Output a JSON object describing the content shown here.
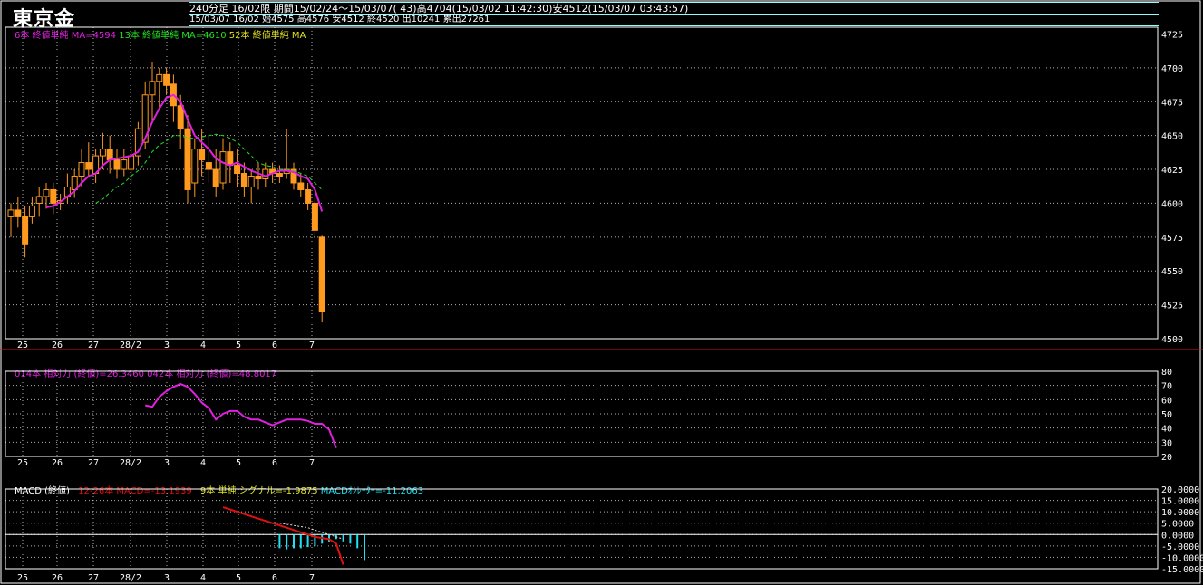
{
  "header": {
    "title": "東京金",
    "period_label": "240分足",
    "contract": "16/02限",
    "range_info": "期間15/02/24〜15/03/07( 43)高4704(15/03/02 11:42:30)安4512(15/03/07 03:43:57)",
    "last_bar_info": "15/03/07 16/02 始4575 高4576 安4512 終4520 出10241 累出27261"
  },
  "legend": {
    "ma1": "6本 終値単純 MA=4594",
    "ma2": "13本 終値単純 MA=4610",
    "ma3": "52本 終値単純 MA",
    "rsi1": "014本 相対力 (終値)=26.3460",
    "rsi2": "042本 相対力 (終値)=48.8017",
    "macd_title": "MACD (終値)",
    "macd_line": "12-26本 MACD=-13.1939",
    "macd_signal": "9本 単純 シグナル=-1.9875",
    "macd_osc": "MACDｵｼﾚｰﾀｰ=-11.2063"
  },
  "colors": {
    "candle": "#ff9a1f",
    "ma6": "#e020e0",
    "ma13": "#20e020",
    "rsi": "#e020e0",
    "macd": "#e01010",
    "signal": "#e0e0e0",
    "osc": "#20e0f0",
    "frame": "#ffffff",
    "divider": "#e01010",
    "grid": "#ffffff"
  },
  "xaxis": {
    "date_labels": [
      "25",
      "26",
      "27",
      "28/2",
      "3",
      "4",
      "5",
      "6",
      "7"
    ]
  },
  "chart_data": [
    {
      "type": "candlestick",
      "ylim": [
        4500,
        4730
      ],
      "yticks": [
        4500,
        4525,
        4550,
        4575,
        4600,
        4625,
        4650,
        4675,
        4700,
        4725
      ],
      "ohlc": [
        [
          4590,
          4600,
          4575,
          4595
        ],
        [
          4595,
          4605,
          4582,
          4590
        ],
        [
          4590,
          4598,
          4560,
          4570
        ],
        [
          4590,
          4605,
          4585,
          4598
        ],
        [
          4600,
          4612,
          4590,
          4605
        ],
        [
          4605,
          4615,
          4596,
          4610
        ],
        [
          4610,
          4615,
          4592,
          4600
        ],
        [
          4600,
          4607,
          4595,
          4602
        ],
        [
          4605,
          4622,
          4600,
          4612
        ],
        [
          4610,
          4625,
          4604,
          4620
        ],
        [
          4620,
          4640,
          4612,
          4630
        ],
        [
          4630,
          4645,
          4620,
          4625
        ],
        [
          4622,
          4640,
          4615,
          4635
        ],
        [
          4635,
          4652,
          4625,
          4640
        ],
        [
          4640,
          4650,
          4622,
          4632
        ],
        [
          4632,
          4640,
          4618,
          4625
        ],
        [
          4625,
          4640,
          4620,
          4632
        ],
        [
          4625,
          4642,
          4615,
          4635
        ],
        [
          4635,
          4660,
          4628,
          4655
        ],
        [
          4645,
          4690,
          4640,
          4680
        ],
        [
          4680,
          4704,
          4660,
          4690
        ],
        [
          4690,
          4700,
          4670,
          4695
        ],
        [
          4695,
          4700,
          4680,
          4687
        ],
        [
          4688,
          4695,
          4660,
          4672
        ],
        [
          4672,
          4680,
          4640,
          4655
        ],
        [
          4655,
          4665,
          4600,
          4610
        ],
        [
          4615,
          4648,
          4605,
          4640
        ],
        [
          4640,
          4655,
          4620,
          4632
        ],
        [
          4630,
          4650,
          4615,
          4625
        ],
        [
          4625,
          4640,
          4605,
          4612
        ],
        [
          4615,
          4648,
          4610,
          4638
        ],
        [
          4638,
          4645,
          4615,
          4628
        ],
        [
          4628,
          4640,
          4612,
          4622
        ],
        [
          4622,
          4630,
          4605,
          4612
        ],
        [
          4612,
          4625,
          4600,
          4620
        ],
        [
          4620,
          4630,
          4610,
          4618
        ],
        [
          4618,
          4630,
          4612,
          4625
        ],
        [
          4625,
          4630,
          4615,
          4622
        ],
        [
          4622,
          4628,
          4615,
          4620
        ],
        [
          4622,
          4655,
          4618,
          4625
        ],
        [
          4625,
          4630,
          4610,
          4615
        ],
        [
          4615,
          4622,
          4605,
          4610
        ],
        [
          4610,
          4615,
          4595,
          4600
        ],
        [
          4600,
          4605,
          4575,
          4580
        ],
        [
          4575,
          4576,
          4512,
          4520
        ]
      ],
      "ma6": [
        null,
        null,
        null,
        null,
        null,
        4597,
        4598,
        4601,
        4605,
        4609,
        4615,
        4620,
        4622,
        4628,
        4632,
        4633,
        4634,
        4635,
        4638,
        4648,
        4660,
        4670,
        4678,
        4680,
        4675,
        4662,
        4650,
        4645,
        4640,
        4633,
        4630,
        4628,
        4630,
        4627,
        4624,
        4622,
        4620,
        4622,
        4624,
        4624,
        4623,
        4620,
        4618,
        4610,
        4594
      ],
      "ma13": [
        null,
        null,
        null,
        null,
        null,
        null,
        null,
        null,
        null,
        null,
        null,
        null,
        4600,
        4603,
        4608,
        4612,
        4615,
        4620,
        4624,
        4630,
        4638,
        4643,
        4646,
        4650,
        4650,
        4648,
        4648,
        4649,
        4650,
        4651,
        4650,
        4648,
        4645,
        4640,
        4635,
        4630,
        4628,
        4627,
        4625,
        4625,
        4624,
        4622,
        4620,
        4615,
        4610
      ]
    },
    {
      "type": "line",
      "name": "RSI",
      "ylim": [
        20,
        80
      ],
      "yticks": [
        20,
        30,
        40,
        50,
        60,
        70,
        80
      ],
      "values": [
        null,
        null,
        null,
        null,
        null,
        null,
        null,
        null,
        null,
        null,
        null,
        null,
        null,
        null,
        null,
        null,
        null,
        null,
        null,
        56,
        55,
        62,
        66,
        69,
        71,
        69,
        64,
        58,
        54,
        46,
        50,
        52,
        52,
        48,
        46,
        46,
        44,
        42,
        44,
        46,
        46,
        46,
        45,
        43,
        43,
        39,
        26
      ]
    },
    {
      "type": "line",
      "name": "MACD",
      "ylim": [
        -15,
        20
      ],
      "yticks": [
        20,
        15,
        10,
        5,
        0,
        -5,
        -10,
        -15
      ],
      "ytick_labels": [
        "20.0000",
        "15.0000",
        "10.0000",
        "5.0000",
        "0.0000",
        "-5.0000",
        "-10.0000",
        "-15.0000"
      ],
      "macd": [
        null,
        null,
        null,
        null,
        null,
        null,
        null,
        null,
        null,
        null,
        null,
        null,
        null,
        null,
        null,
        null,
        null,
        null,
        null,
        null,
        null,
        null,
        null,
        null,
        null,
        null,
        null,
        null,
        null,
        null,
        12,
        11,
        10,
        9,
        8,
        7,
        6,
        5,
        4,
        3,
        2,
        1,
        0,
        -1,
        -1.5,
        -2,
        -4,
        -13.2
      ],
      "signal": [
        null,
        null,
        null,
        null,
        null,
        null,
        null,
        null,
        null,
        null,
        null,
        null,
        null,
        null,
        null,
        null,
        null,
        null,
        null,
        null,
        null,
        null,
        null,
        null,
        null,
        null,
        null,
        null,
        null,
        null,
        null,
        null,
        null,
        null,
        null,
        null,
        null,
        null,
        5,
        4.5,
        4,
        3.5,
        3,
        2,
        1,
        0,
        -1,
        -2
      ],
      "osc": [
        null,
        null,
        null,
        null,
        null,
        null,
        null,
        null,
        null,
        null,
        null,
        null,
        null,
        null,
        null,
        null,
        null,
        null,
        null,
        null,
        null,
        null,
        null,
        null,
        null,
        null,
        null,
        null,
        null,
        null,
        null,
        null,
        null,
        null,
        null,
        null,
        null,
        null,
        -6,
        -6.5,
        -6,
        -6,
        -5.5,
        -5,
        -4,
        -3,
        -2,
        -3,
        -4,
        -6,
        -11.2
      ]
    }
  ]
}
